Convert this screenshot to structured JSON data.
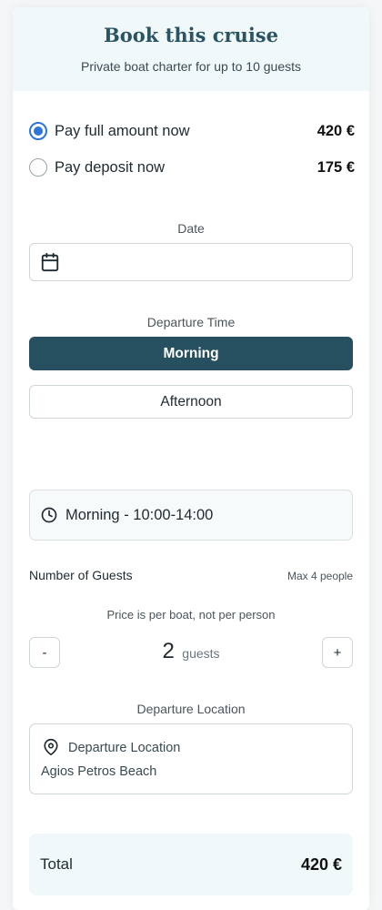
{
  "header": {
    "title": "Book this cruise",
    "subtitle": "Private boat charter for up to 10 guests"
  },
  "payment": {
    "options": [
      {
        "label": "Pay full amount now",
        "amount": "420 €",
        "selected": true
      },
      {
        "label": "Pay deposit now",
        "amount": "175 €",
        "selected": false
      }
    ]
  },
  "date": {
    "label": "Date",
    "value": ""
  },
  "departure_time": {
    "label": "Departure Time",
    "options": [
      {
        "label": "Morning",
        "active": true
      },
      {
        "label": "Afternoon",
        "active": false
      }
    ],
    "selected_slot": "Morning - 10:00-14:00"
  },
  "guests": {
    "label": "Number of Guests",
    "max_note": "Max 4 people",
    "price_note": "Price is per boat, not per person",
    "count": "2",
    "unit": "guests",
    "minus_label": "-",
    "plus_label": "+"
  },
  "location": {
    "section_label": "Departure Location",
    "field_label": "Departure Location",
    "value": "Agios Petros Beach"
  },
  "total": {
    "label": "Total",
    "amount": "420 €"
  },
  "colors": {
    "accent": "#264f5f",
    "radio_checked": "#2f74d6",
    "header_bg": "#f1f8f9"
  }
}
